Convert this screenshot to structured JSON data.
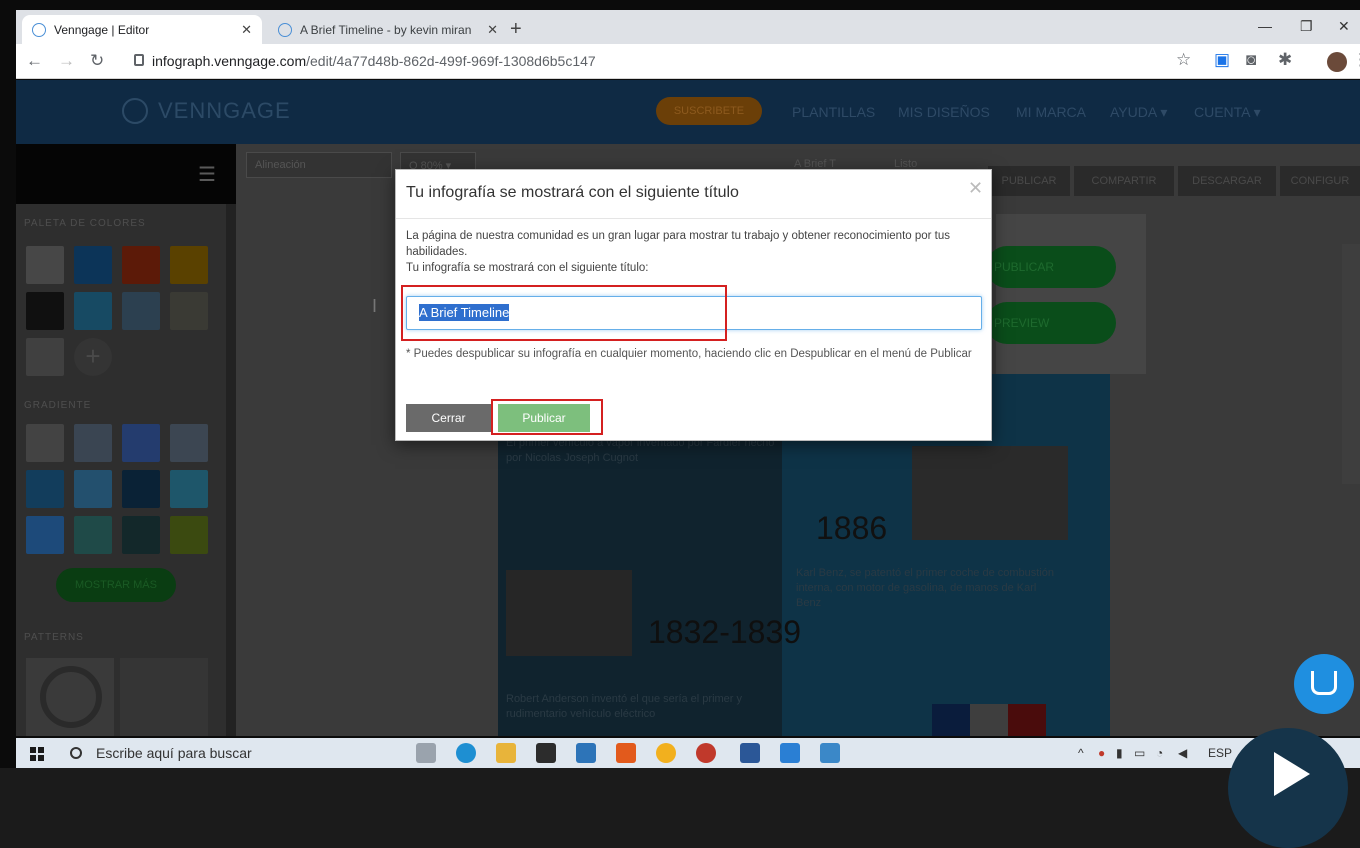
{
  "browser": {
    "tabs": [
      {
        "title": "Venngage | Editor"
      },
      {
        "title": "A Brief Timeline - by kevin miran"
      }
    ],
    "new_tab": "+",
    "url_host": "infograph.venngage.com",
    "url_path": "/edit/4a77d48b-862d-499f-969f-1308d6b5c147"
  },
  "app": {
    "logo": "VENNGAGE",
    "subscribe": "SUSCRIBETE",
    "nav": [
      "PLANTILLAS",
      "MIS DISEÑOS",
      "MI MARCA",
      "AYUDA ▾",
      "CUENTA ▾"
    ]
  },
  "editor": {
    "align_select": "Alineación",
    "zoom": "Q 80% ▾",
    "doc_title": "A Brief T",
    "status": "Listo",
    "actions": [
      "PUBLICAR",
      "COMPARTIR",
      "DESCARGAR",
      "CONFIGUR"
    ],
    "panel_labels": [
      "PALETA DE COLORES",
      "GRADIENTE",
      "PATTERNS"
    ],
    "more_button": "MOSTRAR MÁS",
    "float_buttons": [
      "PUBLICAR",
      "PREVIEW"
    ],
    "infographic": {
      "years": [
        "1886",
        "1832-1839"
      ],
      "text_a": "El primer vehículo a vapor inventado por Fardier hecho por Nicolas Joseph Cugnot",
      "text_b": "Karl Benz, se patentó el primer coche de combustión interna, con motor de gasolina, de manos de Karl Benz",
      "text_c": "Robert Anderson inventó el que sería el primer y rudimentario vehículo eléctrico"
    }
  },
  "modal": {
    "title": "Tu infografía se mostrará con el siguiente título",
    "close": "✕",
    "description": "La página de nuestra comunidad es un gran lugar para mostrar tu trabajo y obtener reconocimiento por tus habilidades.",
    "description2": "Tu infografía se mostrará con el siguiente título:",
    "input_value": "A Brief Timeline",
    "note": "* Puedes despublicar su infografía en cualquier momento, haciendo clic en Despublicar en el menú de Publicar",
    "cancel_label": "Cerrar",
    "publish_label": "Publicar"
  },
  "taskbar": {
    "search_placeholder": "Escribe aquí para buscar",
    "tray_text": "ESP"
  },
  "colors": {
    "accent": "#7dbf7d",
    "highlight": "#d42020",
    "selection": "#2f6fce"
  }
}
